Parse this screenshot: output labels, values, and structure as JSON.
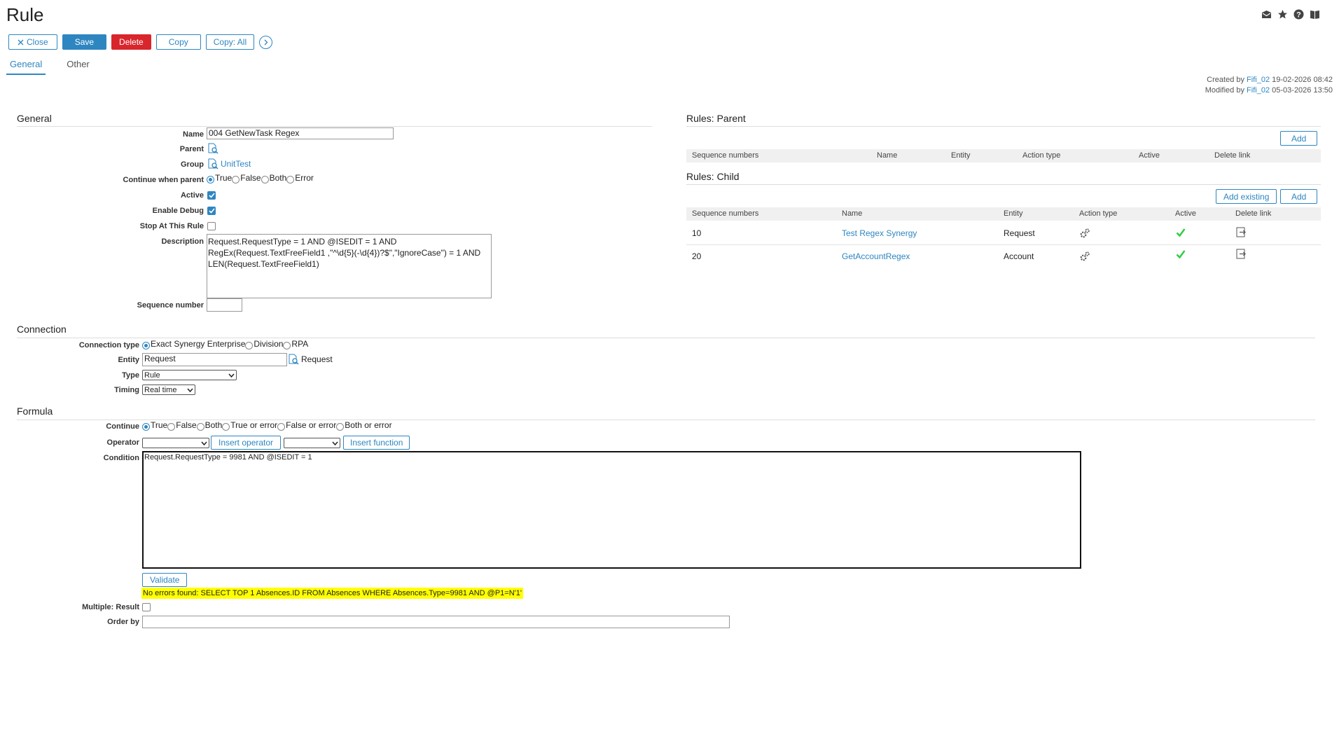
{
  "page": {
    "title": "Rule"
  },
  "toolbar": {
    "close_label": "Close",
    "save_label": "Save",
    "delete_label": "Delete",
    "copy_label": "Copy",
    "copy_all_label": "Copy: All"
  },
  "tabs": [
    {
      "label": "General"
    },
    {
      "label": "Other"
    }
  ],
  "audit": {
    "created_prefix": "Created by",
    "created_user": "Fifi_02",
    "created_date": "19-02-2026 08:42",
    "modified_prefix": "Modified by",
    "modified_user": "Fifi_02",
    "modified_date": "05-03-2026 13:50"
  },
  "general": {
    "section_title": "General",
    "name_label": "Name",
    "name_value": "004 GetNewTask Regex",
    "parent_label": "Parent",
    "group_label": "Group",
    "group_value": "UnitTest",
    "continue_label": "Continue when parent",
    "continue_options": [
      "True",
      "False",
      "Both",
      "Error"
    ],
    "active_label": "Active",
    "active_checked": true,
    "debug_label": "Enable Debug",
    "debug_checked": true,
    "stop_label": "Stop At This Rule",
    "stop_checked": false,
    "description_label": "Description",
    "description_line1": "Request.RequestType = 1 AND @ISEDIT = 1 AND",
    "description_line2": "RegEx(Request.TextFreeField1 ,\"^\\d{5}(-\\d{4})?$\",\"IgnoreCase\")  = 1 AND",
    "description_line3": "LEN(Request.TextFreeField1)",
    "sequence_label": "Sequence number",
    "sequence_value": ""
  },
  "connection": {
    "section_title": "Connection",
    "type_label": "Connection type",
    "type_options": [
      "Exact Synergy Enterprise",
      "Division",
      "RPA"
    ],
    "entity_label": "Entity",
    "entity_value": "Request",
    "entity_display": "Request",
    "kind_label": "Type",
    "kind_value": "Rule",
    "timing_label": "Timing",
    "timing_value": "Real time"
  },
  "formula": {
    "section_title": "Formula",
    "continue_label": "Continue",
    "continue_options": [
      "True",
      "False",
      "Both",
      "True or error",
      "False or error",
      "Both or error"
    ],
    "operator_label": "Operator",
    "operator_value": "",
    "insert_operator_label": "Insert operator",
    "function_value": "",
    "insert_function_label": "Insert function",
    "condition_label": "Condition",
    "condition_value": "Request.RequestType = 9981 AND @ISEDIT = 1",
    "validate_label": "Validate",
    "validation_message": "No errors found: SELECT TOP 1 Absences.ID FROM Absences WHERE Absences.Type=9981 AND @P1=N'1'",
    "multiple_label": "Multiple: Result",
    "order_label": "Order by",
    "order_value": ""
  },
  "rules_parent": {
    "title": "Rules: Parent",
    "add_label": "Add",
    "columns": [
      "Sequence numbers",
      "Name",
      "Entity",
      "Action type",
      "Active",
      "Delete link"
    ]
  },
  "rules_child": {
    "title": "Rules: Child",
    "add_existing_label": "Add existing",
    "add_label": "Add",
    "columns": [
      "Sequence numbers",
      "Name",
      "Entity",
      "Action type",
      "Active",
      "Delete link"
    ],
    "rows": [
      {
        "seq": "10",
        "name": "Test Regex Synergy",
        "entity": "Request",
        "active": true
      },
      {
        "seq": "20",
        "name": "GetAccountRegex",
        "entity": "Account",
        "active": true
      }
    ]
  },
  "colors": {
    "accent": "#2e86c1",
    "danger": "#d9262c",
    "highlight": "#ffff00",
    "check": "#2ecc40"
  },
  "icons": [
    "envelope-icon",
    "star-icon",
    "help-icon",
    "book-icon",
    "close-icon",
    "arrow-right-icon",
    "search-icon",
    "gears-icon",
    "checkmark-icon",
    "link-icon"
  ]
}
